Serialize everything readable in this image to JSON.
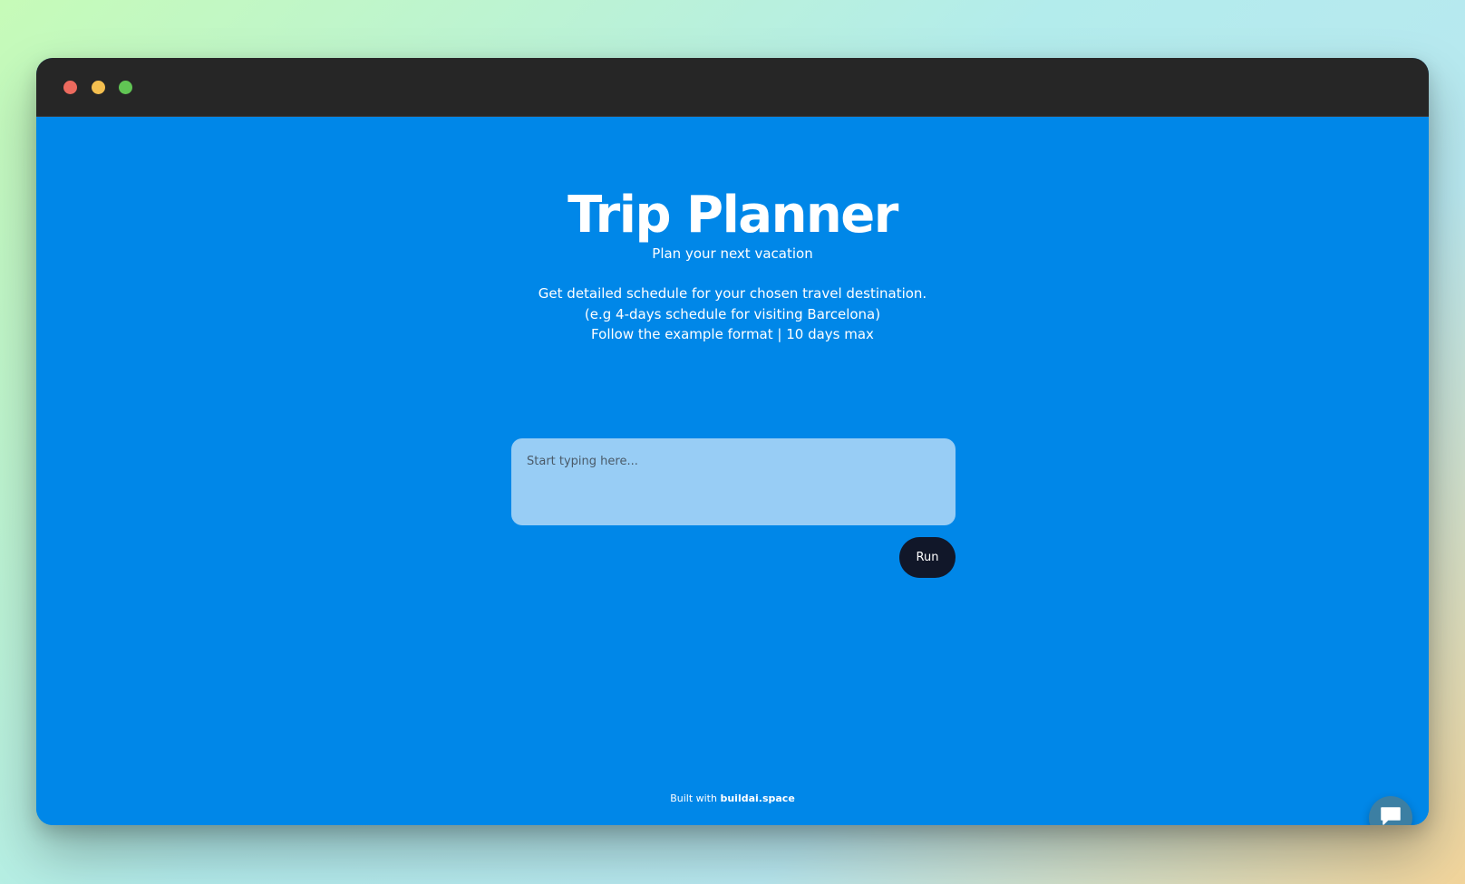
{
  "colors": {
    "window_background": "#0087e8",
    "titlebar": "#262626",
    "close_dot": "#ec6a5e",
    "minimize_dot": "#f4bf4f",
    "maximize_dot": "#61c554",
    "input_background": "#98cdf5",
    "run_button": "#111729",
    "chat_bubble": "#3c7fa3"
  },
  "header": {
    "title": "Trip Planner",
    "subtitle": "Plan your next vacation"
  },
  "description": {
    "lines": [
      "Get detailed schedule for your chosen travel destination.",
      "(e.g 4-days schedule for visiting Barcelona)",
      "Follow the example format | 10 days max"
    ]
  },
  "prompt": {
    "placeholder": "Start typing here...",
    "value": ""
  },
  "actions": {
    "run_label": "Run"
  },
  "footer": {
    "prefix": "Built with",
    "link_text": "buildai.space"
  },
  "icons": {
    "chat": "chat-bubble-icon"
  }
}
